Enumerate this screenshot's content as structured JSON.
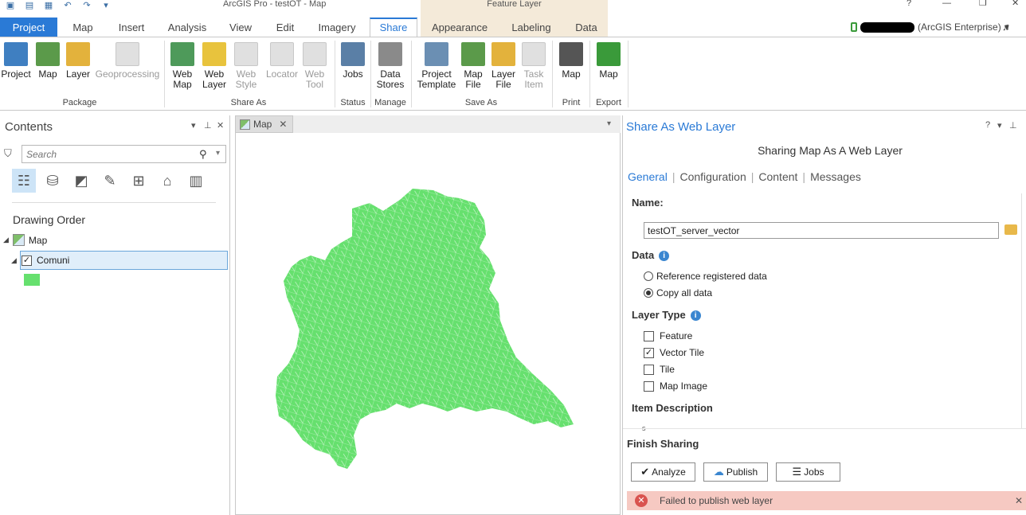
{
  "window": {
    "title": "ArcGIS Pro - testOT - Map",
    "context_title": "Feature Layer",
    "controls": [
      "?",
      "—",
      "❐",
      "✕"
    ]
  },
  "tabs": [
    "Project",
    "Map",
    "Insert",
    "Analysis",
    "View",
    "Edit",
    "Imagery",
    "Share",
    "Appearance",
    "Labeling",
    "Data"
  ],
  "active_tab": "Share",
  "account": {
    "portal": "(ArcGIS Enterprise)",
    "dropdown": "▾"
  },
  "ribbon": {
    "package": {
      "label": "Package",
      "buttons": [
        {
          "label": "Project",
          "color": "#3f7fc1"
        },
        {
          "label": "Map",
          "color": "#5b9a4a"
        },
        {
          "label": "Layer",
          "color": "#e3b23c"
        },
        {
          "label": "Geoprocessing",
          "color": "#bdbdbd"
        }
      ]
    },
    "share_as": {
      "label": "Share As",
      "buttons": [
        {
          "label": "Web Map",
          "color": "#4e9a5a"
        },
        {
          "label": "Web Layer",
          "color": "#e8c33d"
        },
        {
          "label": "Web Style",
          "color": "#bdbdbd"
        },
        {
          "label": "Locator",
          "color": "#bdbdbd"
        },
        {
          "label": "Web Tool",
          "color": "#bdbdbd"
        }
      ]
    },
    "status": {
      "label": "Status",
      "buttons": [
        {
          "label": "Jobs",
          "color": "#5a7fa6"
        }
      ]
    },
    "manage": {
      "label": "Manage",
      "buttons": [
        {
          "label": "Data Stores",
          "color": "#8a8a8a"
        }
      ]
    },
    "save_as": {
      "label": "Save As",
      "buttons": [
        {
          "label": "Project Template",
          "color": "#6b8fb3"
        },
        {
          "label": "Map File",
          "color": "#5b9a4a"
        },
        {
          "label": "Layer File",
          "color": "#e3b23c"
        },
        {
          "label": "Task Item",
          "color": "#bdbdbd"
        }
      ]
    },
    "print": {
      "label": "Print",
      "buttons": [
        {
          "label": "Map",
          "color": "#555555"
        }
      ]
    },
    "export": {
      "label": "Export",
      "buttons": [
        {
          "label": "Map",
          "color": "#3a9a3a"
        }
      ]
    }
  },
  "contents": {
    "title": "Contents",
    "search_placeholder": "Search",
    "drawing_order": "Drawing Order",
    "map_name": "Map",
    "layer_name": "Comuni",
    "layer_checked": true,
    "symbol_color": "#66e06e"
  },
  "map_view": {
    "tab_label": "Map",
    "fill_color": "#66e06e"
  },
  "share_pane": {
    "title": "Share As Web Layer",
    "subtitle": "Sharing Map As A Web Layer",
    "tabs": [
      "General",
      "Configuration",
      "Content",
      "Messages"
    ],
    "active_tab": "General",
    "name_label": "Name:",
    "name_value": "testOT_server_vector",
    "data_label": "Data",
    "data_options": [
      {
        "label": "Reference registered data",
        "selected": false
      },
      {
        "label": "Copy all data",
        "selected": true
      }
    ],
    "layer_type_label": "Layer Type",
    "layer_types": [
      {
        "label": "Feature",
        "checked": false
      },
      {
        "label": "Vector Tile",
        "checked": true
      },
      {
        "label": "Tile",
        "checked": false
      },
      {
        "label": "Map Image",
        "checked": false
      }
    ],
    "item_description_label": "Item Description",
    "finish_label": "Finish Sharing",
    "buttons": {
      "analyze": "Analyze",
      "publish": "Publish",
      "jobs": "Jobs"
    },
    "error_message": "Failed to publish web layer"
  }
}
